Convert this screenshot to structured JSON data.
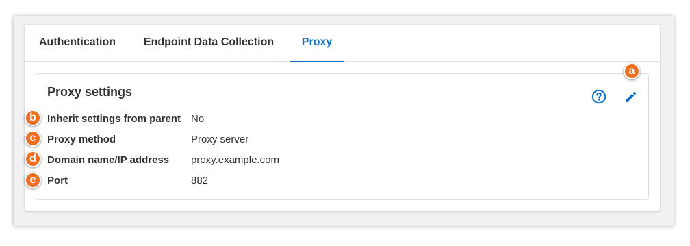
{
  "tabs": [
    {
      "label": "Authentication",
      "active": false
    },
    {
      "label": "Endpoint Data Collection",
      "active": false
    },
    {
      "label": "Proxy",
      "active": true
    }
  ],
  "card": {
    "title": "Proxy settings",
    "help_icon": "question-circle",
    "edit_icon": "pencil"
  },
  "settings": [
    {
      "label": "Inherit settings from parent",
      "value": "No"
    },
    {
      "label": "Proxy method",
      "value": "Proxy server"
    },
    {
      "label": "Domain name/IP address",
      "value": "proxy.example.com"
    },
    {
      "label": "Port",
      "value": "882"
    }
  ],
  "callouts": [
    "a",
    "b",
    "c",
    "d",
    "e"
  ],
  "colors": {
    "accent": "#0d6fc6",
    "callout": "#f06e1f",
    "text": "#333333"
  }
}
